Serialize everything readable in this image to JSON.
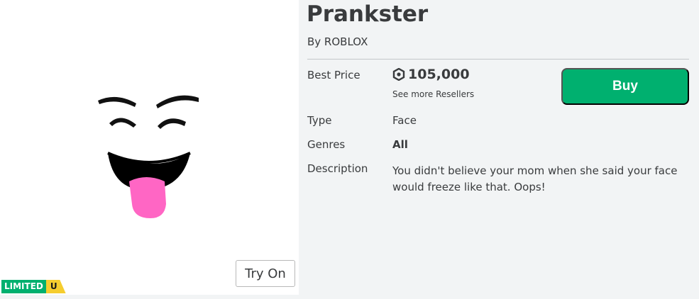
{
  "item": {
    "title": "Prankster",
    "byline": "By ROBLOX"
  },
  "details": {
    "best_price_label": "Best Price",
    "price": "105,000",
    "currency_icon": "robux-icon",
    "resellers_prefix": "See more",
    "resellers_link": "Resellers",
    "buy_label": "Buy",
    "type_label": "Type",
    "type_value": "Face",
    "genres_label": "Genres",
    "genres_value": "All",
    "description_label": "Description",
    "description_value": "You didn't believe your mom when she said your face would freeze like that. Oops!"
  },
  "thumbnail": {
    "try_on_label": "Try On",
    "badge_limited": "LIMITED",
    "badge_u": "U"
  },
  "colors": {
    "buy_green": "#00b06f",
    "limited_green": "#00b06f",
    "limited_u_yellow": "#f5cd2f",
    "tongue_pink": "#ff66c4"
  }
}
